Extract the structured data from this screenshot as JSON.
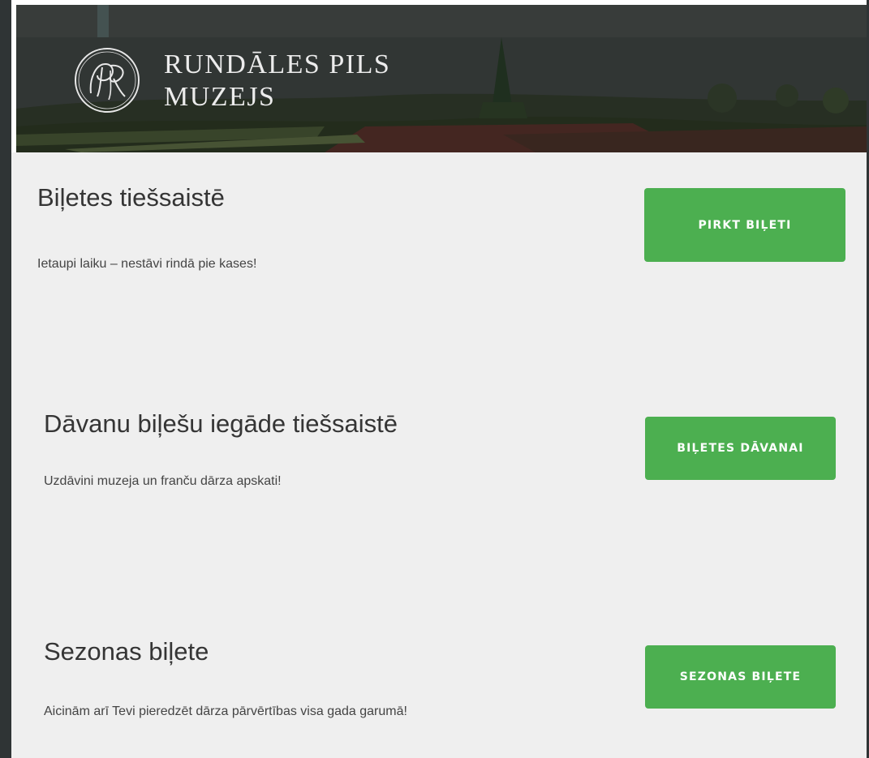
{
  "brand": {
    "line1": "RUNDĀLES PILS",
    "line2": "MUZEJS",
    "emblem_icon": "monogram-rp-emblem-icon"
  },
  "sections": [
    {
      "title": "Biļetes tiešsaistē",
      "description": "Ietaupi laiku – nestāvi rindā pie kases!",
      "button_label": "PIRKT BIĻETI"
    },
    {
      "title": "Dāvanu biļešu iegāde tiešsaistē",
      "description": "Uzdāvini muzeja un franču dārza apskati!",
      "button_label": "BIĻETES DĀVANAI"
    },
    {
      "title": "Sezonas biļete",
      "description": "Aicinām arī Tevi pieredzēt dārza pārvērtības visa gada garumā!",
      "button_label": "SEZONAS BIĻETE"
    }
  ],
  "colors": {
    "button": "#4caf50",
    "page_background": "#efefef",
    "outer_background": "#2f3435"
  }
}
